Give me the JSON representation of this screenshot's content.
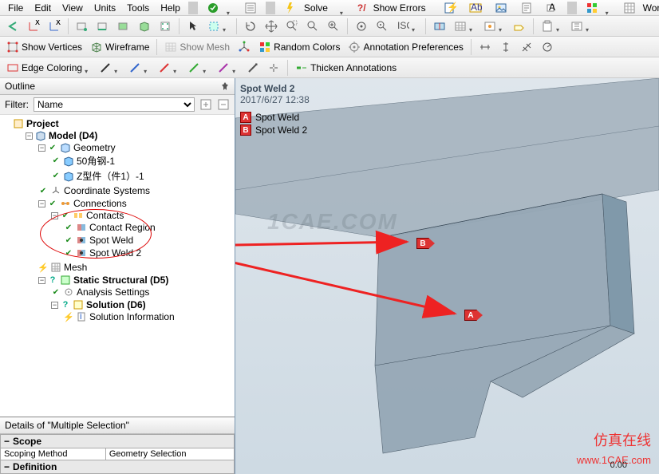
{
  "menu": {
    "file": "File",
    "edit": "Edit",
    "view": "View",
    "units": "Units",
    "tools": "Tools",
    "help": "Help",
    "solve": "Solve",
    "showErrors": "Show Errors",
    "worksheet": "Worksheet"
  },
  "tb3": {
    "showVertices": "Show Vertices",
    "wireframe": "Wireframe",
    "showMesh": "Show Mesh",
    "randomColors": "Random Colors",
    "annotationPrefs": "Annotation Preferences"
  },
  "tb4": {
    "edgeColoring": "Edge Coloring",
    "thicken": "Thicken Annotations"
  },
  "outline": {
    "title": "Outline",
    "filterLabel": "Filter:",
    "filterValue": "Name",
    "project": "Project",
    "model": "Model (D4)",
    "geometry": "Geometry",
    "geo1": "50角钢-1",
    "geo2": "Z型件（件1）-1",
    "coord": "Coordinate Systems",
    "connections": "Connections",
    "contacts": "Contacts",
    "contactRegion": "Contact Region",
    "spotWeld": "Spot Weld",
    "spotWeld2": "Spot Weld 2",
    "mesh": "Mesh",
    "static": "Static Structural (D5)",
    "analysis": "Analysis Settings",
    "solution": "Solution (D6)",
    "solInfo": "Solution Information"
  },
  "details": {
    "title": "Details of \"Multiple Selection\"",
    "scope": "Scope",
    "scopingMethod": "Scoping Method",
    "scopingValue": "Geometry Selection",
    "definition": "Definition"
  },
  "viewport": {
    "title": "Spot Weld 2",
    "date": "2017/6/27 12:38",
    "watermark": "1CAE.COM",
    "wm2": "仿真在线",
    "wm3": "www.1CAE.com",
    "legendA": "Spot Weld",
    "legendB": "Spot Weld 2",
    "A": "A",
    "B": "B",
    "scale": "0.00"
  }
}
